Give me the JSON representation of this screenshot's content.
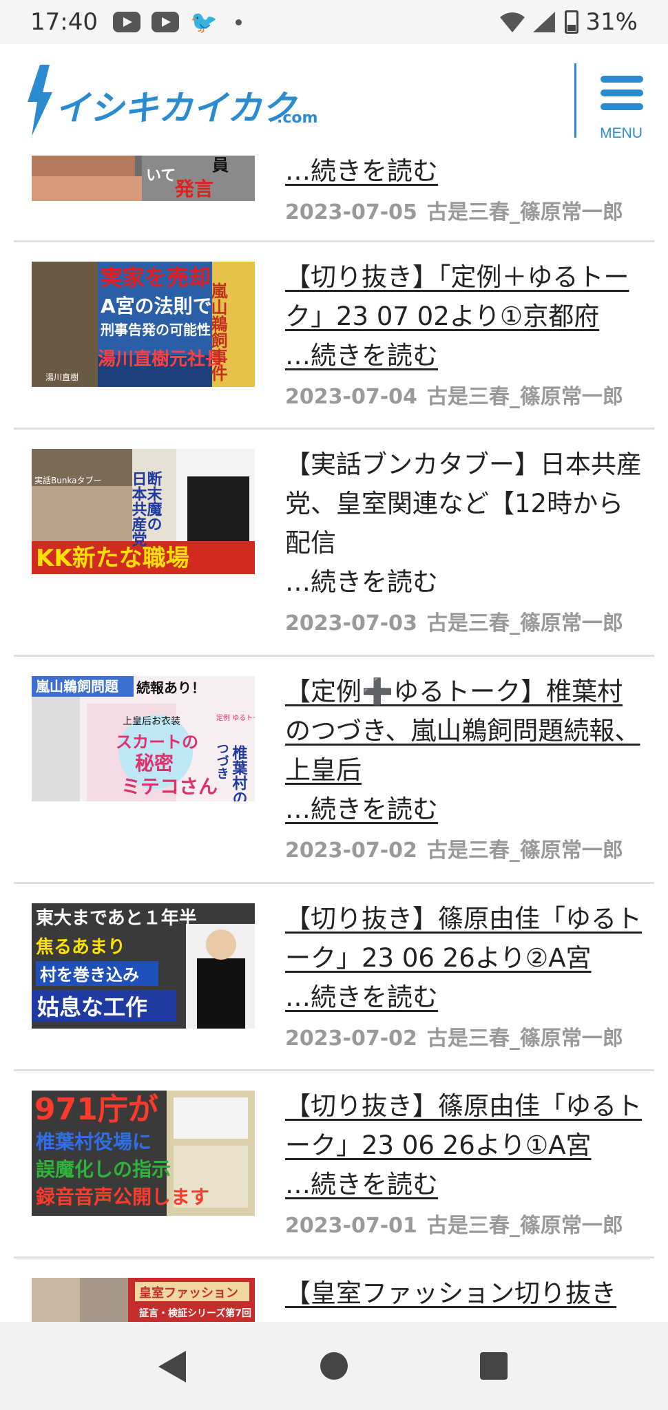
{
  "status": {
    "time": "17:40",
    "battery": "31%"
  },
  "header": {
    "logo_text": "イシキカイカク",
    "logo_suffix": ".com",
    "menu_label": "MENU"
  },
  "articles": [
    {
      "thumb_text": [
        "いて",
        "発言",
        "員"
      ],
      "title": "",
      "read_more": "…続きを読む",
      "date": "2023-07-05",
      "author": "古是三春_篠原常一郎"
    },
    {
      "thumb_text": [
        "実家を売却",
        "A宮の法則で",
        "刑事告発の可能性",
        "湯川直樹元社長",
        "嵐山鵜飼事件",
        "湯川直樹"
      ],
      "title": "【切り抜き】「定例＋ゆるトーク」23 07 02より①京都府",
      "read_more": "…続きを読む",
      "date": "2023-07-04",
      "author": "古是三春_篠原常一郎"
    },
    {
      "thumb_text": [
        "実話Bunkaタブー",
        "断末魔の",
        "日本共産党",
        "KK新たな職場"
      ],
      "title": "【実話ブンカタブー】日本共産党、皇室関連など【12時から配信",
      "read_more": "…続きを読む",
      "date": "2023-07-03",
      "author": "古是三春_篠原常一郎"
    },
    {
      "thumb_text": [
        "嵐山鵜飼問題",
        "続報あり！",
        "上皇后お衣装",
        "スカートの",
        "秘密",
        "ミテコさん",
        "椎葉村の",
        "つづき",
        "定例 ゆるトーク"
      ],
      "title": "【定例➕ゆるトーク】椎葉村のつづき、嵐山鵜飼問題続報、上皇后",
      "read_more": "…続きを読む",
      "date": "2023-07-02",
      "author": "古是三春_篠原常一郎"
    },
    {
      "thumb_text": [
        "東大まであと１年半",
        "焦るあまり",
        "村を巻き込み",
        "姑息な工作"
      ],
      "title": "【切り抜き】篠原由佳「ゆるトーク」23 06 26より②A宮",
      "read_more": "…続きを読む",
      "date": "2023-07-02",
      "author": "古是三春_篠原常一郎"
    },
    {
      "thumb_text": [
        "971庁が",
        "椎葉村役場に",
        "誤魔化しの指示",
        "録音音声公開します"
      ],
      "title": "【切り抜き】篠原由佳「ゆるトーク」23 06 26より①A宮",
      "read_more": "…続きを読む",
      "date": "2023-07-01",
      "author": "古是三春_篠原常一郎"
    },
    {
      "thumb_text": [
        "皇室ファッション",
        "証言・検証シリーズ第7回"
      ],
      "title": "【皇室ファッション切り抜き",
      "read_more": "",
      "date": "",
      "author": ""
    }
  ]
}
